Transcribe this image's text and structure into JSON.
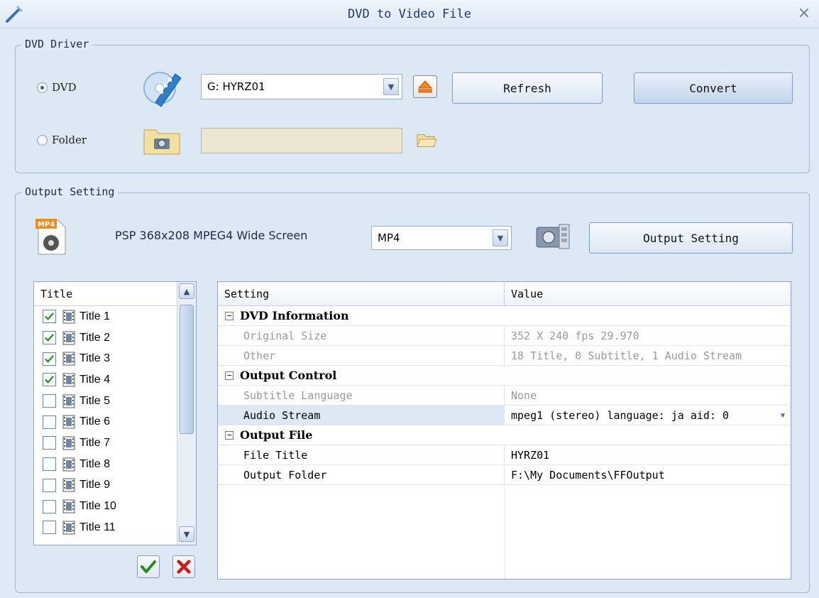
{
  "window": {
    "title": "DVD to Video File",
    "close_glyph": "×",
    "app_icon": "wand-icon"
  },
  "dvd_driver": {
    "group_label": "DVD Driver",
    "dvd_radio_label": "DVD",
    "folder_radio_label": "Folder",
    "selected_source": "DVD",
    "drive_value": "G: HYRZ01",
    "folder_value": "",
    "refresh_label": "Refresh",
    "convert_label": "Convert"
  },
  "output_setting": {
    "group_label": "Output Setting",
    "profile_name": "PSP 368x208 MPEG4 Wide Screen",
    "format_value": "MP4",
    "format_badge": "MP4",
    "output_setting_label": "Output Setting"
  },
  "title_list": {
    "header": "Title",
    "items": [
      {
        "label": "Title 1",
        "checked": true
      },
      {
        "label": "Title 2",
        "checked": true
      },
      {
        "label": "Title 3",
        "checked": true
      },
      {
        "label": "Title 4",
        "checked": true
      },
      {
        "label": "Title 5",
        "checked": false
      },
      {
        "label": "Title 6",
        "checked": false
      },
      {
        "label": "Title 7",
        "checked": false
      },
      {
        "label": "Title 8",
        "checked": false
      },
      {
        "label": "Title 9",
        "checked": false
      },
      {
        "label": "Title 10",
        "checked": false
      },
      {
        "label": "Title 11",
        "checked": false
      }
    ]
  },
  "property_grid": {
    "header_setting": "Setting",
    "header_value": "Value",
    "sections": [
      {
        "name": "DVD Information",
        "rows": [
          {
            "key": "Original Size",
            "value": "352 X 240 fps 29.970",
            "disabled": true
          },
          {
            "key": "Other",
            "value": "18 Title, 0 Subtitle, 1 Audio Stream",
            "disabled": true
          }
        ]
      },
      {
        "name": "Output Control",
        "rows": [
          {
            "key": "Subtitle Language",
            "value": "None",
            "disabled": true
          },
          {
            "key": "Audio Stream",
            "value": "mpeg1 (stereo) language: ja aid: 0",
            "disabled": false,
            "selected": true
          }
        ]
      },
      {
        "name": "Output File",
        "rows": [
          {
            "key": "File Title",
            "value": "HYRZ01",
            "disabled": false
          },
          {
            "key": "Output Folder",
            "value": "F:\\My Documents\\FFOutput",
            "disabled": false
          }
        ]
      }
    ]
  },
  "colors": {
    "background": "#dfeaf6",
    "check_green": "#1e8f1e",
    "cancel_red": "#cc1b1b",
    "disabled_text": "#9a9a9a"
  }
}
